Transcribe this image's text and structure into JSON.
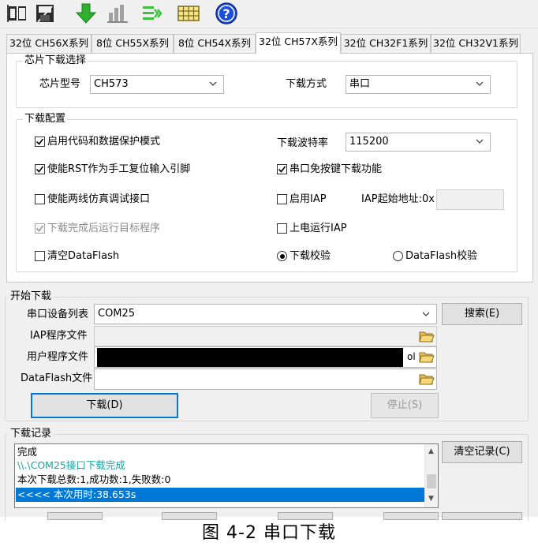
{
  "toolbar": {
    "icons": [
      "open-file-icon",
      "save-file-icon",
      "download-icon",
      "chart-icon",
      "list-check-icon",
      "grid-table-icon",
      "help-icon"
    ]
  },
  "tabs": [
    "32位 CH56X系列",
    "8位 CH55X系列",
    "8位 CH54X系列",
    "32位 CH57X系列",
    "32位 CH32F1系列",
    "32位 CH32V1系列"
  ],
  "active_tab": 3,
  "chip_select": {
    "title": "芯片下载选择",
    "model_label": "芯片型号",
    "model_value": "CH573",
    "method_label": "下载方式",
    "method_value": "串口"
  },
  "download_config": {
    "title": "下载配置",
    "enable_code_protect": "启用代码和数据保护模式",
    "enable_rst": "使能RST作为手工复位输入引脚",
    "enable_debug": "使能两线仿真调试接口",
    "run_after": "下载完成后运行目标程序",
    "clear_dataflash": "清空DataFlash",
    "baud_label": "下载波特率",
    "baud_value": "115200",
    "no_key_download": "串口免按键下载功能",
    "enable_iap": "启用IAP",
    "iap_addr_label": "IAP起始地址:0x",
    "power_on_iap": "上电运行IAP",
    "verify_download": "下载校验",
    "verify_dataflash": "DataFlash校验",
    "checked": {
      "enable_code_protect": true,
      "enable_rst": true,
      "enable_debug": false,
      "run_after": true,
      "clear_dataflash": false,
      "no_key_download": true,
      "enable_iap": false,
      "power_on_iap": false
    },
    "verify_selected": "download"
  },
  "start_download": {
    "title": "开始下载",
    "port_label": "串口设备列表",
    "port_value": "COM25",
    "search_button": "搜索(E)",
    "iap_file_label": "IAP程序文件",
    "user_file_label": "用户程序文件",
    "user_file_tail": "ol",
    "dataflash_label": "DataFlash文件",
    "download_button": "下载(D)",
    "stop_button": "停止(S)"
  },
  "log": {
    "title": "下载记录",
    "clear_button": "清空记录(C)",
    "lines": [
      "完成",
      "\\\\.\\COM25接口下载完成",
      "本次下载总数:1,成功数:1,失败数:0",
      "<<<< 本次用时:38.653s"
    ]
  },
  "caption": "图 4-2  串口下载",
  "colors": {
    "accent": "#0078d7",
    "log_success": "#1aa3a3",
    "panel_bg": "#f0f0f0"
  }
}
